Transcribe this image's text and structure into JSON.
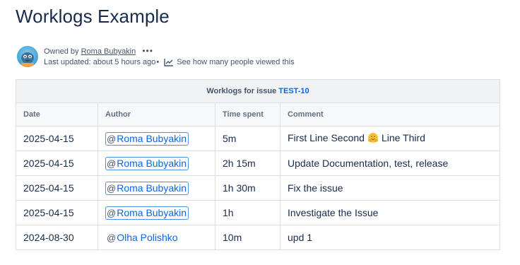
{
  "page": {
    "title": "Worklogs Example"
  },
  "byline": {
    "owned_prefix": "Owned by",
    "owner_name": "Roma Bubyakin",
    "more_label": "•••",
    "updated": "Last updated: about 5 hours ago",
    "dot": "•",
    "viewers_label": "See how many people viewed this"
  },
  "table": {
    "caption_prefix": "Worklogs for issue",
    "issue_key": "TEST-10",
    "headers": [
      "Date",
      "Author",
      "Time spent",
      "Comment"
    ],
    "rows": [
      {
        "date": "2025-04-15",
        "author": "Roma Bubyakin",
        "time": "5m",
        "comment_before": "First Line Second",
        "comment_emoji": "hugging-face-icon",
        "comment_after": "Line Third"
      },
      {
        "date": "2025-04-15",
        "author": "Roma Bubyakin",
        "time": "2h 15m",
        "comment": "Update Documentation, test, release"
      },
      {
        "date": "2025-04-15",
        "author": "Roma Bubyakin",
        "time": "1h 30m",
        "comment": "Fix the issue"
      },
      {
        "date": "2025-04-15",
        "author": "Roma Bubyakin",
        "time": "1h",
        "comment": "Investigate the Issue"
      },
      {
        "date": "2024-08-30",
        "author": "Olha Polishko",
        "time": "10m",
        "comment": "upd 1"
      }
    ]
  },
  "mention_at": "@",
  "colors": {
    "link": "#0c66e4",
    "text": "#172b4d",
    "subtle_text": "#44546f",
    "border": "#dcdfe4",
    "header_bg": "#f7f8f9",
    "caption_bg": "#f1f2f4"
  }
}
